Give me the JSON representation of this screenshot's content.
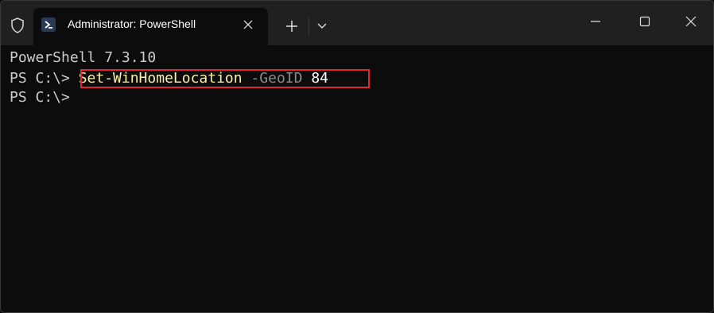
{
  "window": {
    "tab_title": "Administrator: PowerShell"
  },
  "icons": {
    "shield": "shield-icon",
    "powershell": "powershell-icon",
    "close_tab": "close-icon",
    "new_tab": "plus-icon",
    "dropdown": "chevron-down-icon",
    "minimize": "minimize-icon",
    "maximize": "maximize-icon",
    "close_window": "close-icon"
  },
  "terminal": {
    "line1": "PowerShell 7.3.10",
    "prompt1": "PS C:\\>",
    "command": {
      "cmdlet": "Set-WinHomeLocation",
      "parameter": "-GeoID",
      "value": "84"
    },
    "prompt2": "PS C:\\>"
  },
  "colors": {
    "background": "#0c0c0c",
    "titlebar": "#202020",
    "highlight_border": "#e02630",
    "cmdlet": "#f9f1a5",
    "parameter": "#8a8a8a",
    "text": "#cccccc"
  }
}
